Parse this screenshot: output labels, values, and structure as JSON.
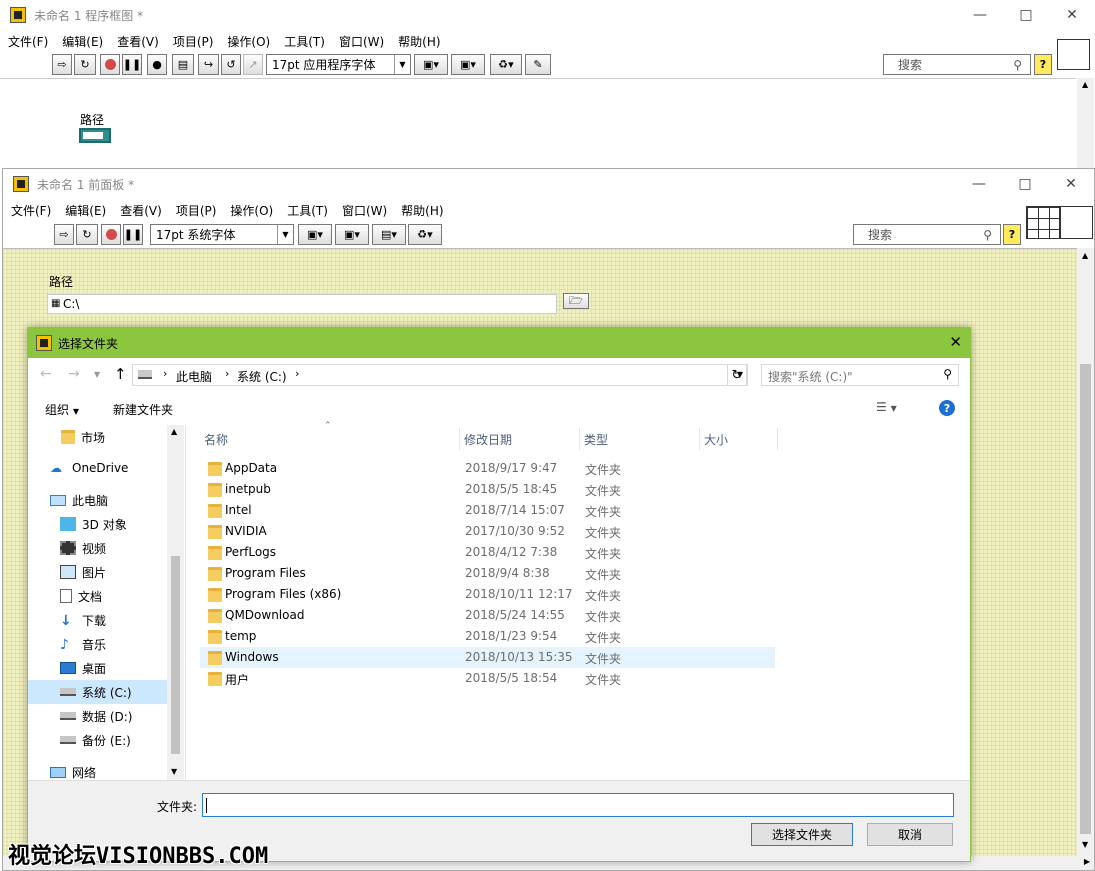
{
  "diagram_window": {
    "title": "未命名 1 程序框图 *",
    "menu": [
      "文件(F)",
      "编辑(E)",
      "查看(V)",
      "项目(P)",
      "操作(O)",
      "工具(T)",
      "窗口(W)",
      "帮助(H)"
    ],
    "font_select": "17pt 应用程序字体",
    "search_placeholder": "搜索",
    "control_label": "路径"
  },
  "panel_window": {
    "title": "未命名 1 前面板 *",
    "menu": [
      "文件(F)",
      "编辑(E)",
      "查看(V)",
      "项目(P)",
      "操作(O)",
      "工具(T)",
      "窗口(W)",
      "帮助(H)"
    ],
    "font_select": "17pt 系统字体",
    "search_placeholder": "搜索",
    "path_label": "路径",
    "path_value": "C:\\"
  },
  "dialog": {
    "title": "选择文件夹",
    "breadcrumb": [
      "此电脑",
      "系统 (C:)"
    ],
    "search_placeholder": "搜索\"系统 (C:)\"",
    "organize_label": "组织",
    "new_folder_label": "新建文件夹",
    "nav": [
      {
        "label": "市场",
        "icon": "folder-icon"
      },
      {
        "label": "OneDrive",
        "icon": "cloud-icon"
      },
      {
        "label": "此电脑",
        "icon": "computer-icon"
      },
      {
        "label": "3D 对象",
        "icon": "cube-icon"
      },
      {
        "label": "视频",
        "icon": "video-icon"
      },
      {
        "label": "图片",
        "icon": "picture-icon"
      },
      {
        "label": "文档",
        "icon": "document-icon"
      },
      {
        "label": "下载",
        "icon": "download-icon"
      },
      {
        "label": "音乐",
        "icon": "music-icon"
      },
      {
        "label": "桌面",
        "icon": "desktop-icon"
      },
      {
        "label": "系统 (C:)",
        "icon": "drive-icon"
      },
      {
        "label": "数据 (D:)",
        "icon": "drive-icon"
      },
      {
        "label": "备份 (E:)",
        "icon": "drive-icon"
      },
      {
        "label": "网络",
        "icon": "network-icon"
      }
    ],
    "columns": [
      "名称",
      "修改日期",
      "类型",
      "大小"
    ],
    "files": [
      {
        "name": "AppData",
        "date": "2018/9/17 9:47",
        "type": "文件夹"
      },
      {
        "name": "inetpub",
        "date": "2018/5/5 18:45",
        "type": "文件夹"
      },
      {
        "name": "Intel",
        "date": "2018/7/14 15:07",
        "type": "文件夹"
      },
      {
        "name": "NVIDIA",
        "date": "2017/10/30 9:52",
        "type": "文件夹"
      },
      {
        "name": "PerfLogs",
        "date": "2018/4/12 7:38",
        "type": "文件夹"
      },
      {
        "name": "Program Files",
        "date": "2018/9/4 8:38",
        "type": "文件夹"
      },
      {
        "name": "Program Files (x86)",
        "date": "2018/10/11 12:17",
        "type": "文件夹"
      },
      {
        "name": "QMDownload",
        "date": "2018/5/24 14:55",
        "type": "文件夹"
      },
      {
        "name": "temp",
        "date": "2018/1/23 9:54",
        "type": "文件夹"
      },
      {
        "name": "Windows",
        "date": "2018/10/13 15:35",
        "type": "文件夹"
      },
      {
        "name": "用户",
        "date": "2018/5/5 18:54",
        "type": "文件夹"
      }
    ],
    "folder_label": "文件夹:",
    "folder_value": "",
    "select_button": "选择文件夹",
    "cancel_button": "取消",
    "accent_color": "#8cc63e"
  },
  "watermark": "视觉论坛VISIONBBS.COM"
}
